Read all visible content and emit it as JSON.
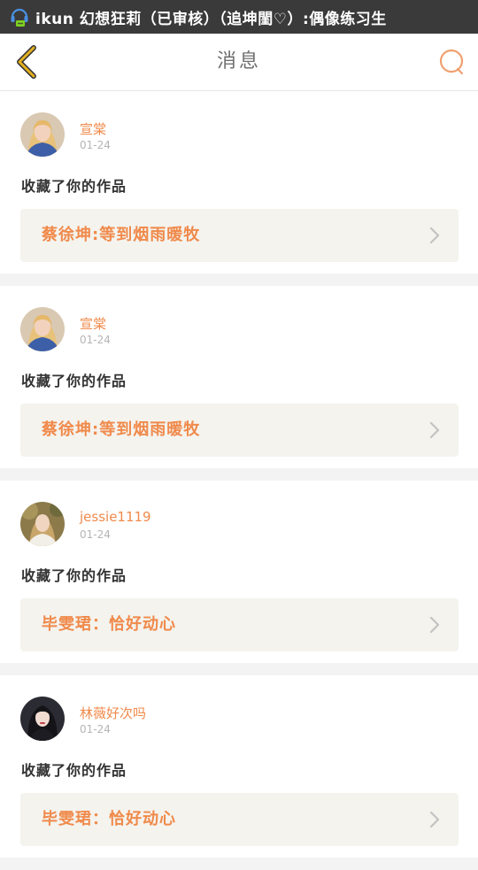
{
  "status_bar": {
    "notification": "ikun 幻想狂莉（已审核）（追坤閨♡）:偶像练习生"
  },
  "header": {
    "title": "消息"
  },
  "colors": {
    "accent": "#f08a4b",
    "back_arrow": "#e4b020",
    "search": "#f0a070"
  },
  "messages": [
    {
      "user": "宣棠",
      "date": "01-24",
      "action": "收藏了你的作品",
      "work_title": "蔡徐坤:等到烟雨暖牧",
      "avatar_icon": "avatar-blonde-woman"
    },
    {
      "user": "宣棠",
      "date": "01-24",
      "action": "收藏了你的作品",
      "work_title": "蔡徐坤:等到烟雨暖牧",
      "avatar_icon": "avatar-blonde-woman"
    },
    {
      "user": "jessie1119",
      "date": "01-24",
      "action": "收藏了你的作品",
      "work_title": "毕雯珺：恰好动心",
      "avatar_icon": "avatar-woman-in-garden"
    },
    {
      "user": "林薇好次吗",
      "date": "01-24",
      "action": "收藏了你的作品",
      "work_title": "毕雯珺：恰好动心",
      "avatar_icon": "avatar-dark-hair-woman"
    }
  ]
}
